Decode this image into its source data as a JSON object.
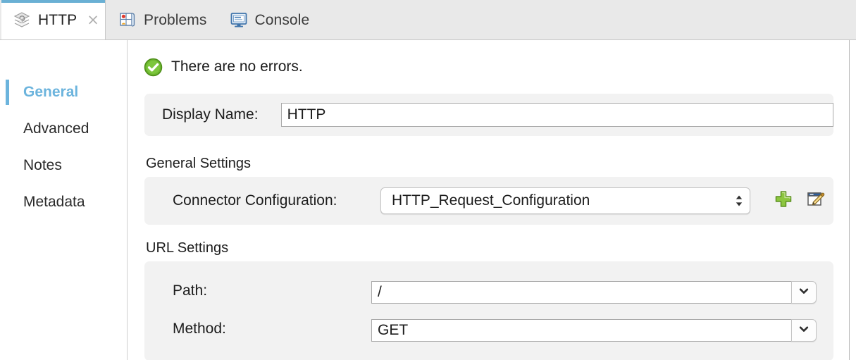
{
  "window": {
    "tabs": [
      {
        "label": "HTTP",
        "icon": "http-connector-icon",
        "active": true,
        "closable": true,
        "close_glyph": "×"
      },
      {
        "label": "Problems",
        "icon": "problems-icon",
        "active": false,
        "closable": false
      },
      {
        "label": "Console",
        "icon": "console-monitor-icon",
        "active": false,
        "closable": false
      }
    ]
  },
  "sidebar": {
    "items": [
      {
        "label": "General",
        "selected": true
      },
      {
        "label": "Advanced",
        "selected": false
      },
      {
        "label": "Notes",
        "selected": false
      },
      {
        "label": "Metadata",
        "selected": false
      }
    ]
  },
  "main": {
    "status": {
      "icon": "success-check-icon",
      "text": "There are no errors."
    },
    "display_name": {
      "label": "Display Name:",
      "value": "HTTP",
      "placeholder": ""
    },
    "general_settings": {
      "title": "General Settings",
      "connector_configuration": {
        "label": "Connector Configuration:",
        "value": "HTTP_Request_Configuration",
        "options": [
          "HTTP_Request_Configuration"
        ],
        "add_button": {
          "icon": "add-plus-icon",
          "tooltip": "Add"
        },
        "edit_button": {
          "icon": "edit-pencil-icon",
          "tooltip": "Edit"
        }
      }
    },
    "url_settings": {
      "title": "URL Settings",
      "path": {
        "label": "Path:",
        "value": "/",
        "placeholder": ""
      },
      "method": {
        "label": "Method:",
        "value": "GET",
        "placeholder": ""
      }
    }
  },
  "colors": {
    "accent": "#6cb4dd",
    "tab_bar_bg": "#e9e9e9",
    "panel_bg": "#f2f2f2",
    "success": "#6cb52f",
    "add_icon": "#8cc63f",
    "text": "#1c1c1c"
  }
}
